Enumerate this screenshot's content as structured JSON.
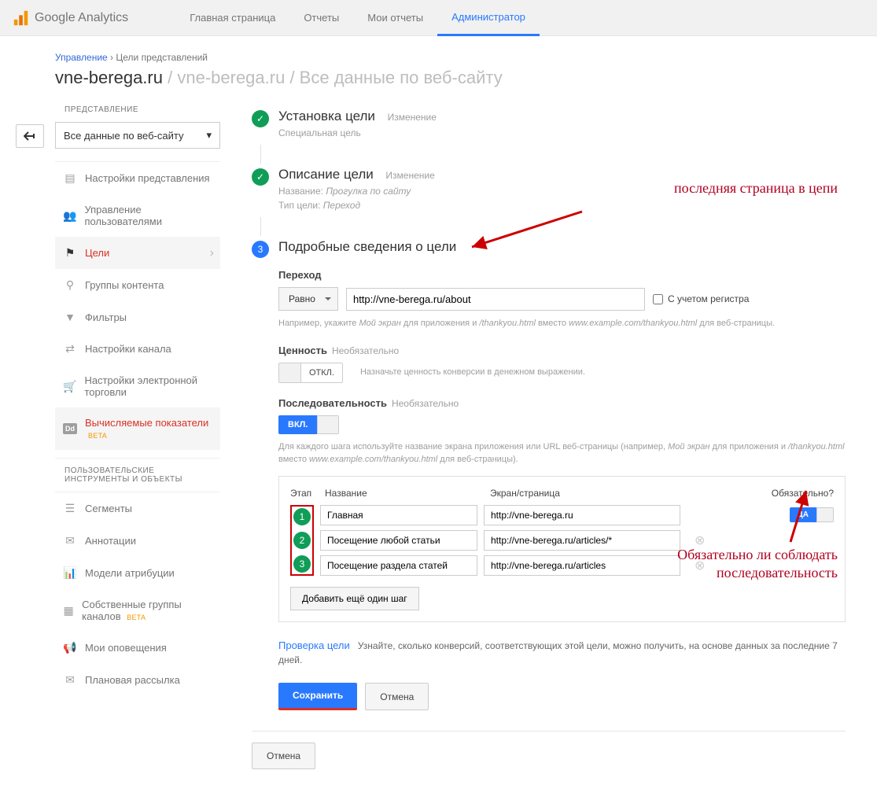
{
  "brand": "Google Analytics",
  "tabs": {
    "home": "Главная страница",
    "reports": "Отчеты",
    "my_reports": "Мои отчеты",
    "admin": "Администратор"
  },
  "breadcrumb": {
    "manage": "Управление",
    "goals": "Цели представлений"
  },
  "title": {
    "account": "vne-berega.ru",
    "property": "vne-berega.ru",
    "view": "Все данные по веб-сайту"
  },
  "sidebar": {
    "section": "ПРЕДСТАВЛЕНИЕ",
    "view_select": "Все данные по веб-сайту",
    "items": [
      {
        "label": "Настройки представления"
      },
      {
        "label": "Управление пользователями"
      },
      {
        "label": "Цели"
      },
      {
        "label": "Группы контента"
      },
      {
        "label": "Фильтры"
      },
      {
        "label": "Настройки канала"
      },
      {
        "label": "Настройки электронной торговли"
      },
      {
        "label": "Вычисляемые показатели",
        "badge": "BETA",
        "dd": "Dd"
      }
    ],
    "tools_section": "ПОЛЬЗОВАТЕЛЬСКИЕ ИНСТРУМЕНТЫ И ОБЪЕКТЫ",
    "tools": [
      {
        "label": "Сегменты"
      },
      {
        "label": "Аннотации"
      },
      {
        "label": "Модели атрибуции"
      },
      {
        "label": "Собственные группы каналов",
        "badge": "BETA"
      },
      {
        "label": "Мои оповещения"
      },
      {
        "label": "Плановая рассылка"
      }
    ]
  },
  "steps": {
    "s1_title": "Установка цели",
    "s1_edit": "Изменение",
    "s1_desc": "Специальная цель",
    "s2_title": "Описание цели",
    "s2_edit": "Изменение",
    "s2_name_lbl": "Название:",
    "s2_name_val": "Прогулка по сайту",
    "s2_type_lbl": "Тип цели:",
    "s2_type_val": "Переход",
    "s3_num": "3",
    "s3_title": "Подробные сведения о цели"
  },
  "destination": {
    "label": "Переход",
    "match_type": "Равно",
    "url": "http://vne-berega.ru/about",
    "case_sensitive": "С учетом регистра",
    "hint_pre": "Например, укажите ",
    "hint_i1": "Мой экран",
    "hint_mid1": " для приложения и ",
    "hint_i2": "/thankyou.html",
    "hint_mid2": " вместо ",
    "hint_i3": "www.example.com/thankyou.html",
    "hint_post": " для веб-страницы."
  },
  "value": {
    "label": "Ценность",
    "optional": "Необязательно",
    "off": "ОТКЛ.",
    "hint": "Назначьте ценность конверсии в денежном выражении."
  },
  "funnel": {
    "label": "Последовательность",
    "optional": "Необязательно",
    "on": "ВКЛ.",
    "hint_pre": "Для каждого шага используйте название экрана приложения или URL веб-страницы (например, ",
    "hint_i1": "Мой экран",
    "hint_mid1": " для приложения и ",
    "hint_i2": "/thankyou.html",
    "hint_mid2": " вместо ",
    "hint_i3": "www.example.com/thankyou.html",
    "hint_post": " для веб-страницы).",
    "h_step": "Этап",
    "h_name": "Название",
    "h_screen": "Экран/страница",
    "h_required": "Обязательно?",
    "required_yes": "ДА",
    "rows": [
      {
        "n": "1",
        "name": "Главная",
        "url": "http://vne-berega.ru"
      },
      {
        "n": "2",
        "name": "Посещение любой статьи",
        "url": "http://vne-berega.ru/articles/*"
      },
      {
        "n": "3",
        "name": "Посещение раздела статей",
        "url": "http://vne-berega.ru/articles"
      }
    ],
    "add_step": "Добавить ещё один шаг"
  },
  "verify": {
    "link": "Проверка цели",
    "text": "Узнайте, сколько конверсий, соответствующих этой цели, можно получить, на основе данных за последние 7 дней."
  },
  "buttons": {
    "save": "Сохранить",
    "cancel": "Отмена",
    "cancel_bottom": "Отмена"
  },
  "annotations": {
    "a1": "последняя страница в цепи",
    "a2": "Обязательно ли соблюдать последовательность"
  }
}
